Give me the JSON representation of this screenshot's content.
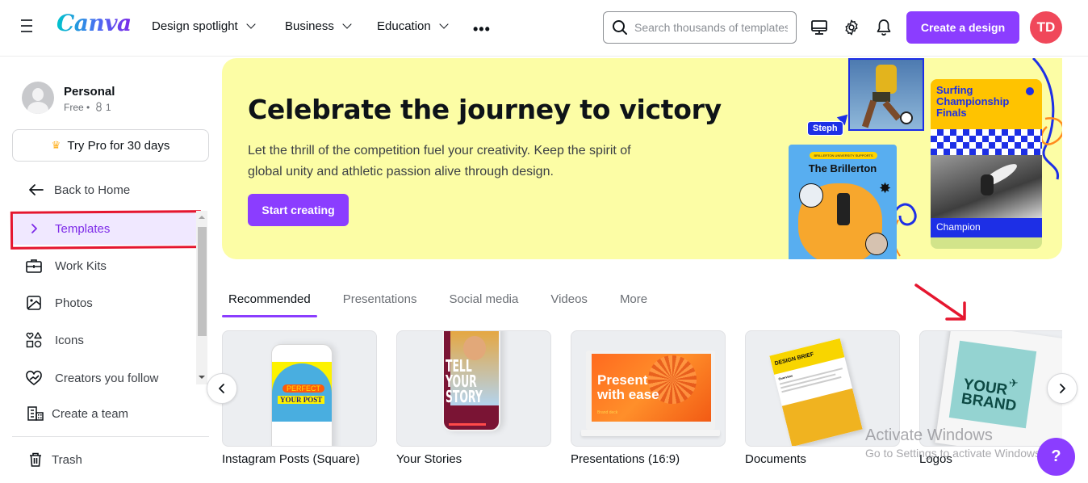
{
  "header": {
    "logo": "Canva",
    "nav": [
      {
        "label": "Design spotlight",
        "has_dropdown": true
      },
      {
        "label": "Business",
        "has_dropdown": true
      },
      {
        "label": "Education",
        "has_dropdown": true
      }
    ],
    "more_label": "•••",
    "search": {
      "placeholder": "Search thousands of templates",
      "value": ""
    },
    "icons": [
      "desktop-icon",
      "gear-icon",
      "bell-icon"
    ],
    "create_button": "Create a design",
    "user_initials": "TD",
    "colors": {
      "brand": "#8b3dff",
      "avatar": "#f0485a"
    }
  },
  "sidebar": {
    "account": {
      "name": "Personal",
      "plan": "Free",
      "separator": "•",
      "members": "1"
    },
    "try_pro": {
      "label": "Try Pro for 30 days",
      "icon": "crown-icon"
    },
    "back": {
      "label": "Back to Home",
      "icon": "arrow-left-icon"
    },
    "items": [
      {
        "label": "Templates",
        "icon": "chevron-right-icon",
        "active": true
      },
      {
        "label": "Work Kits",
        "icon": "briefcase-icon"
      },
      {
        "label": "Photos",
        "icon": "image-icon"
      },
      {
        "label": "Icons",
        "icon": "shapes-icon"
      },
      {
        "label": "Creators you follow",
        "icon": "heart-check-icon"
      }
    ],
    "create_team": {
      "label": "Create a team",
      "icon": "building-icon"
    },
    "trash": {
      "label": "Trash",
      "icon": "trash-icon"
    }
  },
  "hero": {
    "title": "Celebrate the journey to victory",
    "description": "Let the thrill of the competition fuel your creativity. Keep the spirit of global unity and athletic passion alive through design.",
    "button": "Start creating",
    "background": "#fcfda5",
    "art": {
      "cursor_tag": "Steph",
      "poster1_tagline": "BRILLERTON UNIVERSITY SUPPORTS",
      "poster1_title": "The Brillerton",
      "poster2_title": "Surfing Championship Finals",
      "poster2_footer": "Champion"
    }
  },
  "tabs": [
    {
      "label": "Recommended",
      "active": true
    },
    {
      "label": "Presentations"
    },
    {
      "label": "Social media"
    },
    {
      "label": "Videos"
    },
    {
      "label": "More"
    }
  ],
  "cards": [
    {
      "label": "Instagram Posts (Square)",
      "art_line1": "PERFECT",
      "art_line2": "YOUR POST"
    },
    {
      "label": "Your Stories",
      "art_line1": "TELL",
      "art_line2": "YOUR",
      "art_line3": "STORY"
    },
    {
      "label": "Presentations (16:9)",
      "art_line1": "Present",
      "art_line2": "with ease",
      "art_line3": "Brand deck"
    },
    {
      "label": "Documents",
      "art_line1": "DESIGN BRIEF",
      "art_line2": "Overview"
    },
    {
      "label": "Logos",
      "art_line1": "YOUR",
      "art_line2": "BRAND"
    }
  ],
  "overlay": {
    "watermark_title": "Activate Windows",
    "watermark_sub": "Go to Settings to activate Windows.",
    "help_label": "?"
  }
}
